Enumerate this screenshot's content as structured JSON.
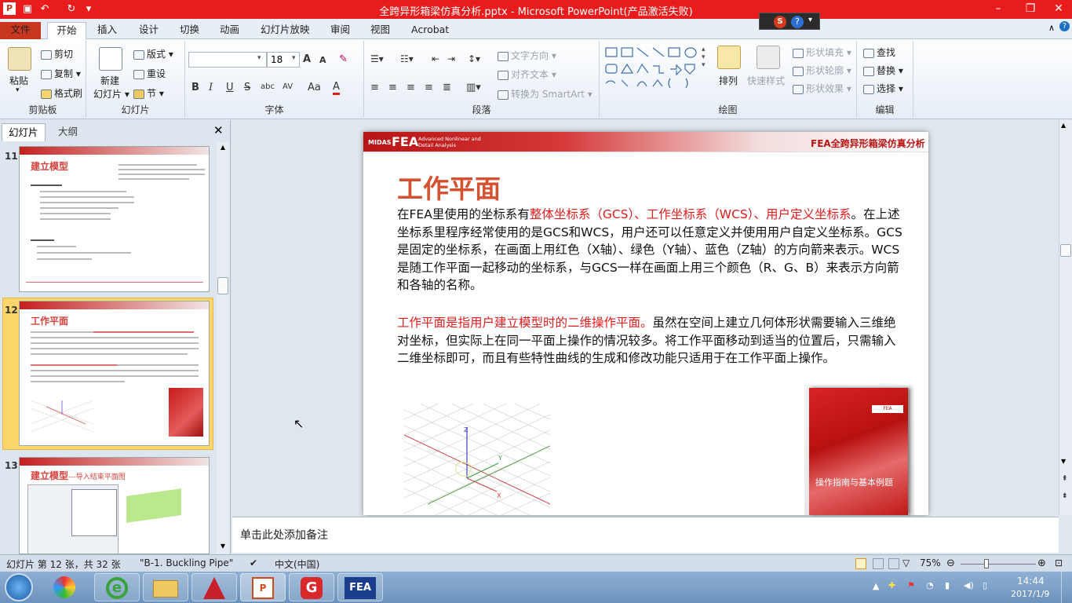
{
  "window": {
    "title": "全跨异形箱梁仿真分析.pptx - Microsoft PowerPoint(产品激活失败)",
    "controls": {
      "minimize": "–",
      "restore": "❐",
      "close": "✕"
    }
  },
  "quick_access": [
    "save-icon",
    "undo-icon",
    "redo-icon",
    "customize-icon"
  ],
  "tabs": {
    "file": "文件",
    "items": [
      "开始",
      "插入",
      "设计",
      "切换",
      "动画",
      "幻灯片放映",
      "审阅",
      "视图",
      "Acrobat"
    ],
    "active": "开始"
  },
  "ribbon": {
    "clipboard": {
      "paste": "粘贴",
      "cut": "剪切",
      "copy": "复制",
      "format_painter": "格式刷",
      "label": "剪贴板"
    },
    "slides": {
      "new_slide_1": "新建",
      "new_slide_2": "幻灯片",
      "layout": "版式",
      "reset": "重设",
      "section": "节",
      "label": "幻灯片"
    },
    "font": {
      "font_name": "",
      "font_size": "18",
      "grow": "A",
      "shrink": "A",
      "bold": "B",
      "italic": "I",
      "underline": "U",
      "strike": "S",
      "shadow": "abc",
      "spacing": "AV",
      "case": "Aa",
      "color": "A",
      "label": "字体"
    },
    "paragraph": {
      "text_direction": "文字方向",
      "align_text": "对齐文本",
      "convert_smartart": "转换为 SmartArt",
      "label": "段落"
    },
    "drawing": {
      "arrange": "排列",
      "quick_styles": "快速样式",
      "shape_fill": "形状填充",
      "shape_outline": "形状轮廓",
      "shape_effects": "形状效果",
      "label": "绘图"
    },
    "editing": {
      "find": "查找",
      "replace": "替换",
      "select": "选择",
      "label": "编辑"
    }
  },
  "left_pane": {
    "tab_slides": "幻灯片",
    "tab_outline": "大纲",
    "thumbnails": [
      {
        "num": "11",
        "title": "建立模型",
        "active": false
      },
      {
        "num": "12",
        "title": "工作平面",
        "active": true
      },
      {
        "num": "13",
        "title": "建立模型",
        "subtitle": "---导入结束平面图",
        "active": false
      }
    ]
  },
  "slide": {
    "brand": "FEA",
    "brand_prefix": "MIDAS",
    "brand_sub": "Advanced Nonlinear and Detail Analysis",
    "header_title": "FEA全跨异形箱梁仿真分析",
    "title": "工作平面",
    "para1_red1": "整体坐标系（GCS）、工作坐标系（WCS）、用户定义坐标系",
    "para1_pre": "在FEA里使用的坐标系有",
    "para1_rest": "。在上述坐标系里程序经常使用的是GCS和WCS，用户还可以任意定义并使用用户自定义坐标系。GCS是固定的坐标系，在画面上用红色（X轴）、绿色（Y轴）、蓝色（Z轴）的方向箭来表示。WCS是随工作平面一起移动的坐标系，与GCS一样在画面上用三个颜色（R、G、B）来表示方向箭和各轴的名称。",
    "para2_red": "工作平面是指用户建立模型时的二维操作平面。",
    "para2_rest": "虽然在空间上建立几何体形状需要输入三维绝对坐标，但实际上在同一平面上操作的情况较多。将工作平面移动到适当的位置后，只需输入二维坐标即可，而且有些特性曲线的生成和修改功能只适用于在工作平面上操作。",
    "book_title": "操作指南与基本例题",
    "axis_labels": {
      "z": "Z",
      "y": "Y",
      "x": "X"
    }
  },
  "notes": {
    "placeholder": "单击此处添加备注"
  },
  "status": {
    "slide_info": "幻灯片 第 12 张，共 32 张",
    "theme": "\"B-1. Buckling Pipe\"",
    "language": "中文(中国)",
    "zoom": "75%"
  },
  "tray": {
    "time": "14:44",
    "date": "2017/1/9"
  },
  "colors": {
    "accent_red": "#e81c1c",
    "title_orange": "#d45231",
    "text_red": "#e01c1c"
  }
}
